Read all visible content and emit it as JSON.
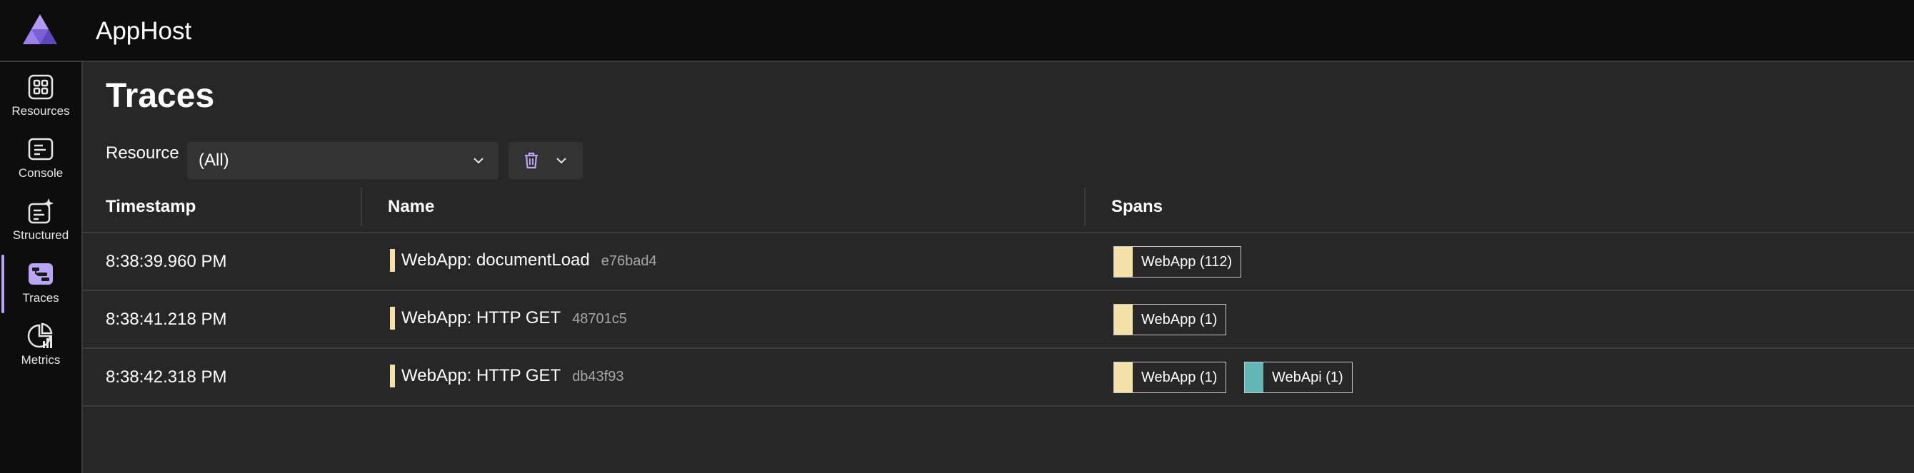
{
  "app": {
    "title": "AppHost"
  },
  "sidebar": {
    "items": [
      {
        "label": "Resources",
        "icon": "resources-icon",
        "active": false
      },
      {
        "label": "Console",
        "icon": "console-icon",
        "active": false
      },
      {
        "label": "Structured",
        "icon": "structured-icon",
        "active": false
      },
      {
        "label": "Traces",
        "icon": "traces-icon",
        "active": true
      },
      {
        "label": "Metrics",
        "icon": "metrics-icon",
        "active": false
      }
    ]
  },
  "page": {
    "title": "Traces"
  },
  "filters": {
    "resource_label": "Resource",
    "resource_value": "(All)"
  },
  "table": {
    "columns": [
      "Timestamp",
      "Name",
      "Spans"
    ],
    "rows": [
      {
        "timestamp": "8:38:39.960 PM",
        "name": "WebApp: documentLoad",
        "trace_id": "e76bad4",
        "spans": [
          {
            "label": "WebApp (112)",
            "color": "#f3e1a8"
          }
        ]
      },
      {
        "timestamp": "8:38:41.218 PM",
        "name": "WebApp: HTTP GET",
        "trace_id": "48701c5",
        "spans": [
          {
            "label": "WebApp (1)",
            "color": "#f3e1a8"
          }
        ]
      },
      {
        "timestamp": "8:38:42.318 PM",
        "name": "WebApp: HTTP GET",
        "trace_id": "db43f93",
        "spans": [
          {
            "label": "WebApp (1)",
            "color": "#f3e1a8"
          },
          {
            "label": "WebApi (1)",
            "color": "#63b6b6"
          }
        ]
      }
    ]
  },
  "colors": {
    "accent": "#b9a5f5",
    "webapp": "#f3e1a8",
    "webapi": "#63b6b6"
  }
}
